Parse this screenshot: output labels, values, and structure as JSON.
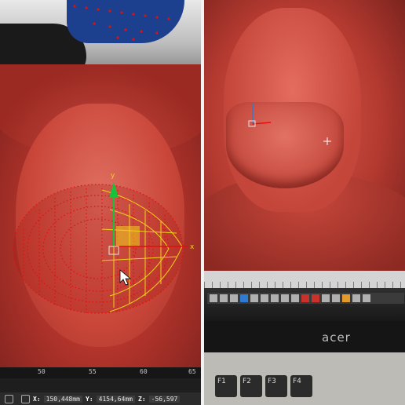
{
  "left_view": {
    "ruler_ticks": [
      "50",
      "55",
      "60",
      "65"
    ],
    "status": {
      "x_label": "X:",
      "x_value": "150,448mm",
      "y_label": "Y:",
      "y_value": "4154,64mm",
      "z_label": "Z:",
      "z_value": "-56,597"
    }
  },
  "right_view": {
    "monitor_brand": "acer",
    "keys": [
      "F1",
      "F2",
      "F3",
      "F4"
    ]
  },
  "colors": {
    "sculpt_red": "#c9463a",
    "lattice_red": "#e01010",
    "gizmo_yellow": "#f0d21a",
    "gizmo_green": "#18c23a"
  }
}
